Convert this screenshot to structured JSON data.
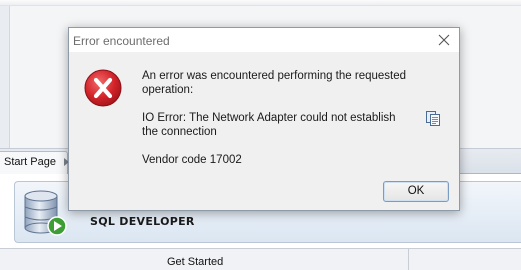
{
  "background": {
    "tab_label": "Start Page",
    "product_name": "SQL DEVELOPER",
    "get_started_label": "Get Started"
  },
  "dialog": {
    "title": "Error encountered",
    "message": "An error was encountered performing the requested operation:",
    "error_detail": "IO Error: The Network Adapter could not establish the connection",
    "vendor_code": "Vendor code 17002",
    "ok_label": "OK",
    "close_icon": "close-icon",
    "error_icon": "error-x-icon",
    "copy_icon": "copy-icon"
  },
  "colors": {
    "error_red": "#d2232a",
    "dialog_bg": "#f0f0f0",
    "ok_border": "#7a9cc2",
    "banner_blue": "#dbe6f2"
  }
}
